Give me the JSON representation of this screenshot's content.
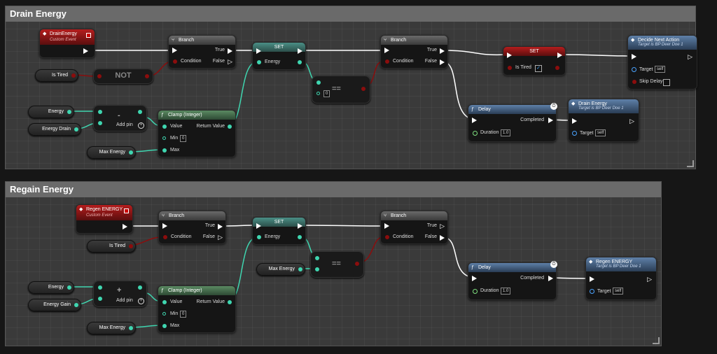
{
  "comments": {
    "drain_title": "Drain Energy",
    "regain_title": "Regain Energy"
  },
  "drain": {
    "event": {
      "title": "DrainEnergy",
      "subtitle": "Custom Event"
    },
    "is_tired_var": "Is Tired",
    "not_label": "NOT",
    "branch1": {
      "title": "Branch",
      "true": "True",
      "condition": "Condition",
      "false": "False"
    },
    "set1": {
      "title": "SET",
      "energy": "Energy"
    },
    "equals": {
      "op": "==",
      "value": "0"
    },
    "branch2": {
      "title": "Branch",
      "true": "True",
      "condition": "Condition",
      "false": "False"
    },
    "set2": {
      "title": "SET",
      "is_tired": "Is Tired",
      "checked": "✓"
    },
    "decide": {
      "title": "Decide Next Action",
      "subtitle": "Target is BP Deer Doe 1",
      "target": "Target",
      "target_value": "self",
      "skip": "Skip Delay"
    },
    "energy_var": "Energy",
    "energy_drain_var": "Energy Drain",
    "minus": {
      "op": "-",
      "add_pin": "Add pin"
    },
    "clamp": {
      "title": "Clamp (Integer)",
      "value": "Value",
      "return": "Return Value",
      "min": "Min",
      "min_value": "0",
      "max": "Max"
    },
    "max_energy_var": "Max Energy",
    "delay": {
      "title": "Delay",
      "completed": "Completed",
      "duration": "Duration",
      "duration_value": "1.0"
    },
    "drain_call": {
      "title": "Drain Energy",
      "subtitle": "Target is BP Deer Doe 1",
      "target": "Target",
      "target_value": "self"
    }
  },
  "regain": {
    "event": {
      "title": "Regen ENERGY",
      "subtitle": "Custom Event"
    },
    "branch1": {
      "title": "Branch",
      "true": "True",
      "condition": "Condition",
      "false": "False"
    },
    "is_tired_var": "Is Tired",
    "set1": {
      "title": "SET",
      "energy": "Energy"
    },
    "max_energy_var": "Max Energy",
    "equals": {
      "op": "=="
    },
    "branch2": {
      "title": "Branch",
      "true": "True",
      "condition": "Condition",
      "false": "False"
    },
    "energy_var": "Energy",
    "energy_gain_var": "Energy Gain",
    "plus": {
      "op": "+",
      "add_pin": "Add pin"
    },
    "clamp": {
      "title": "Clamp (Integer)",
      "value": "Value",
      "return": "Return Value",
      "min": "Min",
      "min_value": "0",
      "max": "Max"
    },
    "max_energy_var2": "Max Energy",
    "delay": {
      "title": "Delay",
      "completed": "Completed",
      "duration": "Duration",
      "duration_value": "1.0"
    },
    "regen_call": {
      "title": "Regen ENERGY",
      "subtitle": "Target is BP Deer Doe 1",
      "target": "Target",
      "target_value": "self"
    }
  },
  "colors": {
    "exec": "#ffffff",
    "int_pin": "#3fd6b0",
    "bool_pin": "#8b0d0d",
    "float_pin": "#7fe07f",
    "object_pin": "#4aa3ff",
    "event_header": "#b51d1d",
    "function_header": "#5e80a8"
  }
}
